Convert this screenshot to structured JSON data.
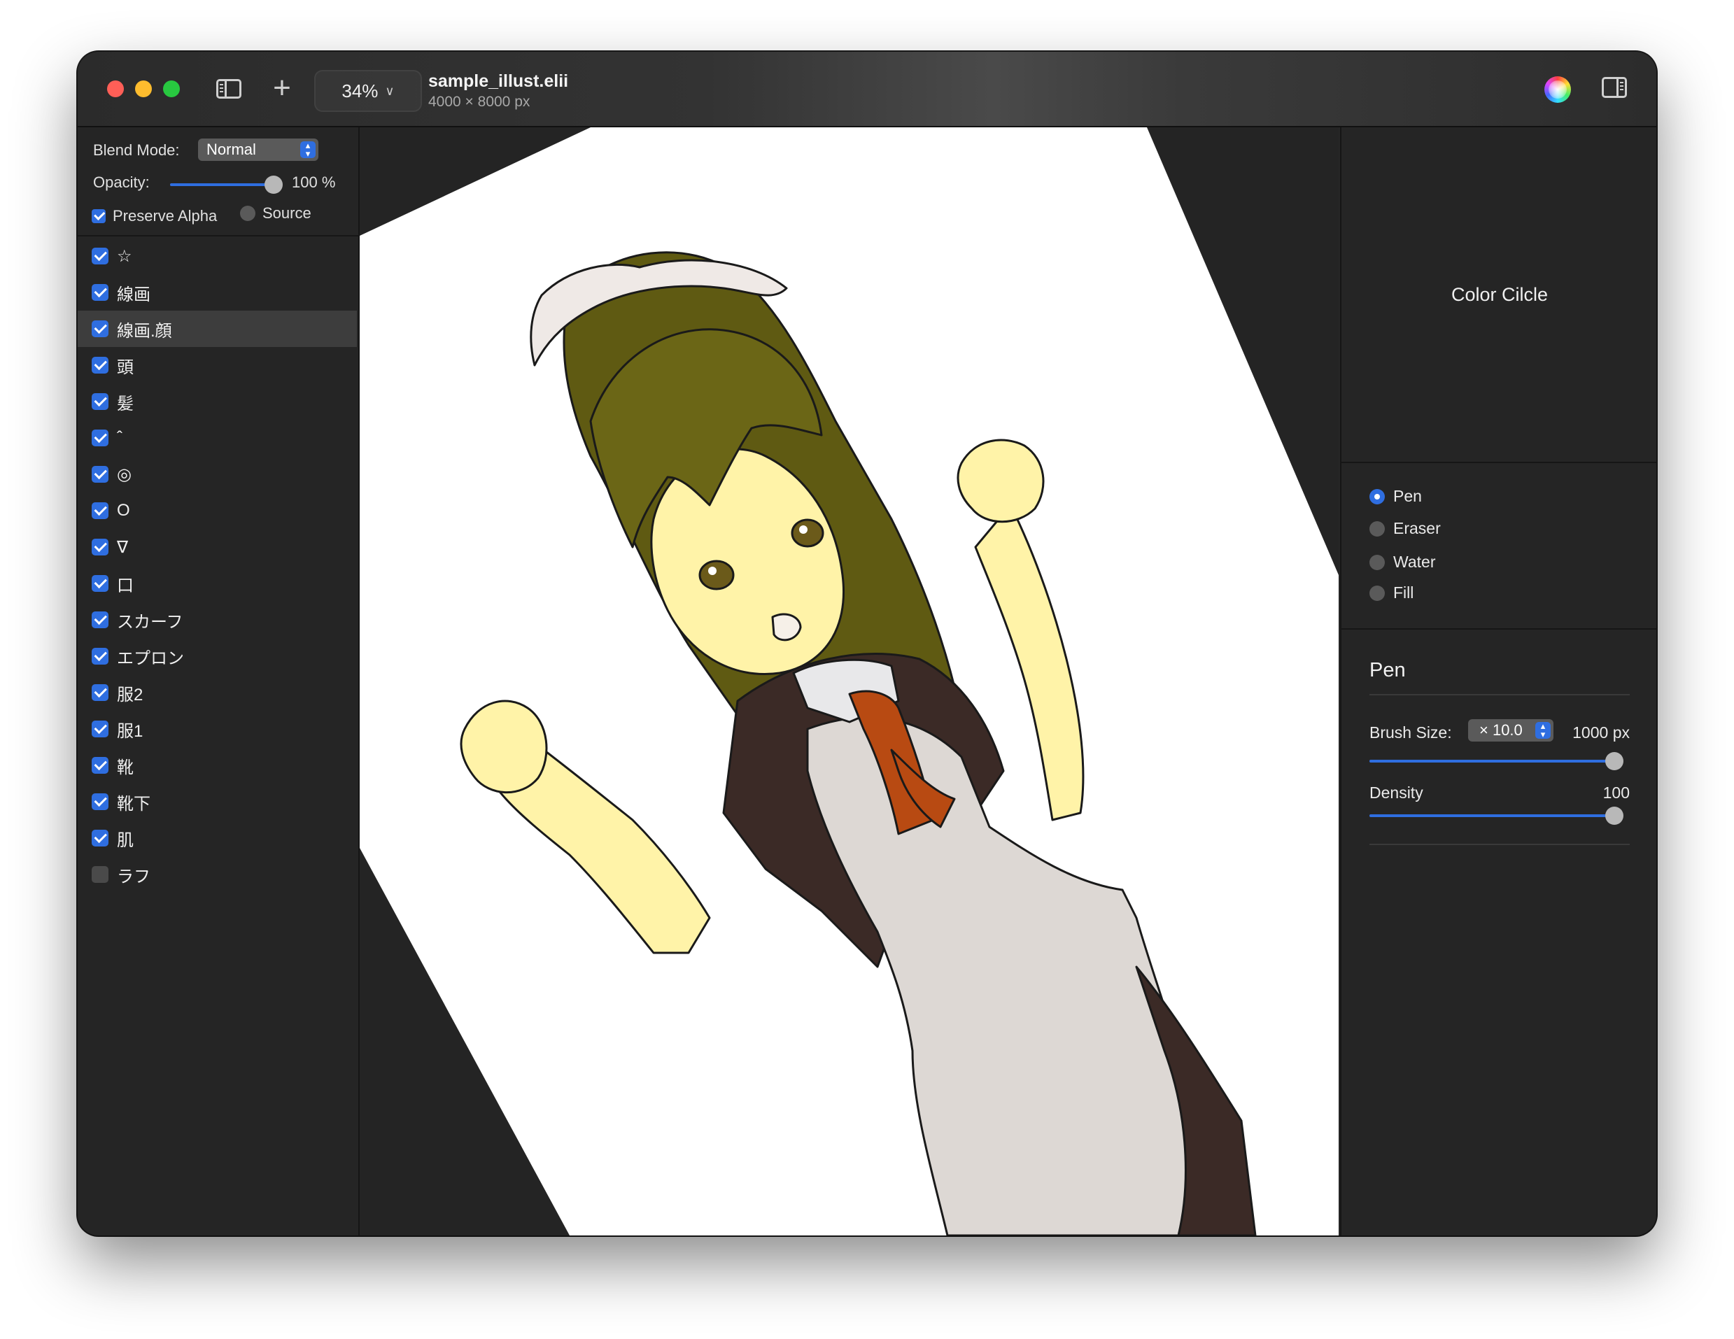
{
  "window": {
    "title": "sample_illust.elii",
    "subtitle": "4000 × 8000 px",
    "zoom": "34%",
    "add_label": "+"
  },
  "left_panel": {
    "blend_mode_label": "Blend Mode:",
    "blend_mode_value": "Normal",
    "opacity_label": "Opacity:",
    "opacity_value": "100 %",
    "opacity_fraction": 1.0,
    "preserve_alpha_label": "Preserve Alpha",
    "preserve_alpha_checked": true,
    "source_label": "Source",
    "source_selected": false,
    "selected_layer_index": 2,
    "layers": [
      {
        "name": "☆",
        "visible": true
      },
      {
        "name": "線画",
        "visible": true
      },
      {
        "name": "線画.顔",
        "visible": true
      },
      {
        "name": "頭",
        "visible": true
      },
      {
        "name": "髪",
        "visible": true
      },
      {
        "name": "ˆ",
        "visible": true
      },
      {
        "name": "◎",
        "visible": true
      },
      {
        "name": "O",
        "visible": true
      },
      {
        "name": "∇",
        "visible": true
      },
      {
        "name": "口",
        "visible": true
      },
      {
        "name": "スカーフ",
        "visible": true
      },
      {
        "name": "エプロン",
        "visible": true
      },
      {
        "name": "服2",
        "visible": true
      },
      {
        "name": "服1",
        "visible": true
      },
      {
        "name": "靴",
        "visible": true
      },
      {
        "name": "靴下",
        "visible": true
      },
      {
        "name": "肌",
        "visible": true
      },
      {
        "name": "ラフ",
        "visible": false
      }
    ]
  },
  "right_panel": {
    "color_circle_label": "Color Cilcle",
    "tools": [
      {
        "name": "Pen",
        "selected": true
      },
      {
        "name": "Eraser",
        "selected": false
      },
      {
        "name": "Water",
        "selected": false
      },
      {
        "name": "Fill",
        "selected": false
      }
    ],
    "pen_section_title": "Pen",
    "brush_size_label": "Brush Size:",
    "brush_multiplier": "× 10.0",
    "brush_size_value": "1000 px",
    "brush_size_fraction": 1.0,
    "density_label": "Density",
    "density_value": "100",
    "density_fraction": 1.0
  },
  "colors": {
    "accent": "#2f6ee0",
    "panel_bg": "#252525",
    "canvas_bg": "#242424",
    "paper": "#ffffff",
    "hair": "#5f5a12",
    "skin": "#fff3a8",
    "dress": "#3b2a26",
    "apron": "#ddd8d4",
    "scarf": "#b84a12"
  }
}
